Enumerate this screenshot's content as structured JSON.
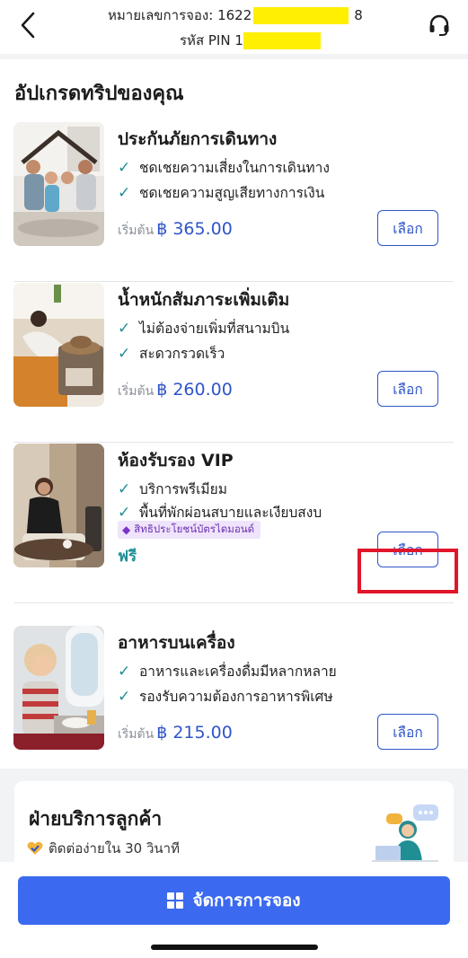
{
  "header": {
    "booking_label": "หมายเลขการจอง:",
    "booking_prefix": "1622",
    "booking_suffix": "8",
    "pin_label": "รหัส PIN",
    "pin_prefix": "1"
  },
  "section": {
    "title": "อัปเกรดทริปของคุณ"
  },
  "items": [
    {
      "title": "ประกันภัยการเดินทาง",
      "features": [
        "ชดเชยความเสี่ยงในการเดินทาง",
        "ชดเชยความสูญเสียทางการเงิน"
      ],
      "price_prefix": "เริ่มต้น",
      "price": "฿ 365.00",
      "button": "เลือก"
    },
    {
      "title": "น้ำหนักสัมภาระเพิ่มเติม",
      "features": [
        "ไม่ต้องจ่ายเพิ่มที่สนามบิน",
        "สะดวกรวดเร็ว"
      ],
      "price_prefix": "เริ่มต้น",
      "price": "฿ 260.00",
      "button": "เลือก"
    },
    {
      "title": "ห้องรับรอง VIP",
      "features": [
        "บริการพรีเมียม",
        "พื้นที่พักผ่อนสบายและเงียบสงบ"
      ],
      "badge": "สิทธิประโยชน์บัตรไดมอนด์",
      "free_label": "ฟรี",
      "button": "เลือก"
    },
    {
      "title": "อาหารบนเครื่อง",
      "features": [
        "อาหารและเครื่องดื่มมีหลากหลาย",
        "รองรับความต้องการอาหารพิเศษ"
      ],
      "price_prefix": "เริ่มต้น",
      "price": "฿ 215.00",
      "button": "เลือก"
    }
  ],
  "customer_service": {
    "title": "ฝ่ายบริการลูกค้า",
    "subtitle": "ติดต่อง่ายใน 30 วินาที"
  },
  "bottom": {
    "manage_label": "จัดการการจอง"
  },
  "colors": {
    "accent": "#3b6af0",
    "check": "#1f8f94",
    "price": "#2f55c8",
    "highlight": "#e0162b"
  },
  "icons": [
    "back-arrow-icon",
    "headset-icon",
    "check-icon",
    "diamond-icon",
    "heart-check-icon",
    "grid-icon"
  ]
}
